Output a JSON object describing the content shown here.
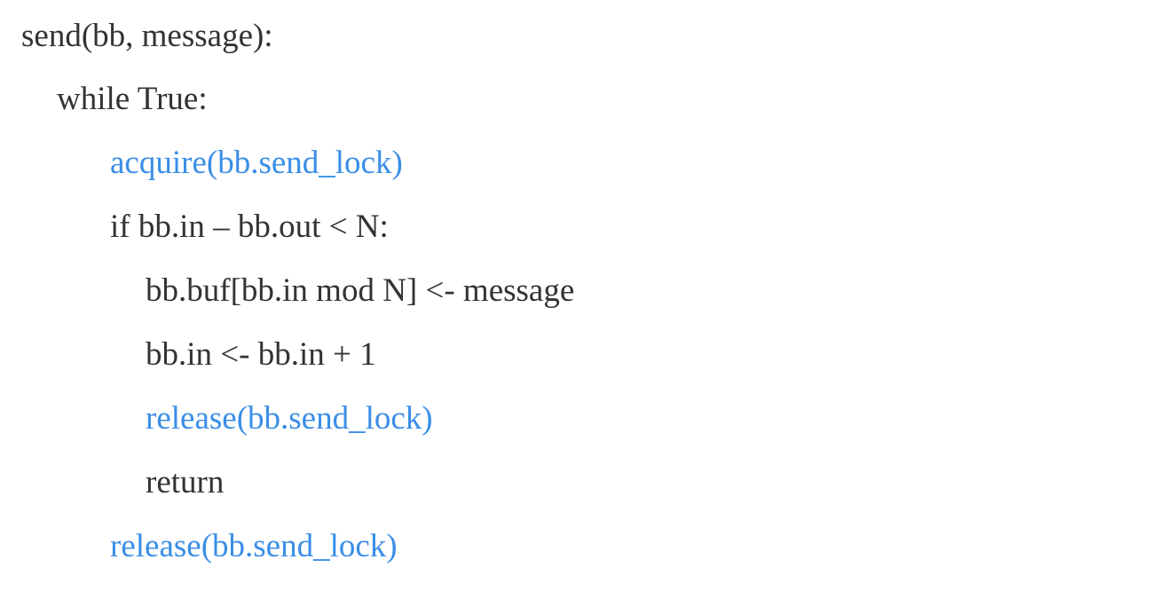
{
  "colors": {
    "text": "#333333",
    "lock_highlight": "#3a8ee6",
    "background": "#ffffff"
  },
  "code": {
    "lines": [
      {
        "text": "send(bb, message):",
        "indent": 0,
        "highlight": false
      },
      {
        "text": "while True:",
        "indent": 1,
        "highlight": false
      },
      {
        "text": "acquire(bb.send_lock)",
        "indent": 2,
        "highlight": true
      },
      {
        "text": "if bb.in – bb.out < N:",
        "indent": 2,
        "highlight": false
      },
      {
        "text": "bb.buf[bb.in mod N] <- message",
        "indent": 3,
        "highlight": false
      },
      {
        "text": "bb.in <- bb.in + 1",
        "indent": 3,
        "highlight": false
      },
      {
        "text": "release(bb.send_lock)",
        "indent": 3,
        "highlight": true
      },
      {
        "text": "return",
        "indent": 3,
        "highlight": false
      },
      {
        "text": "release(bb.send_lock)",
        "indent": 2,
        "highlight": true
      }
    ]
  }
}
